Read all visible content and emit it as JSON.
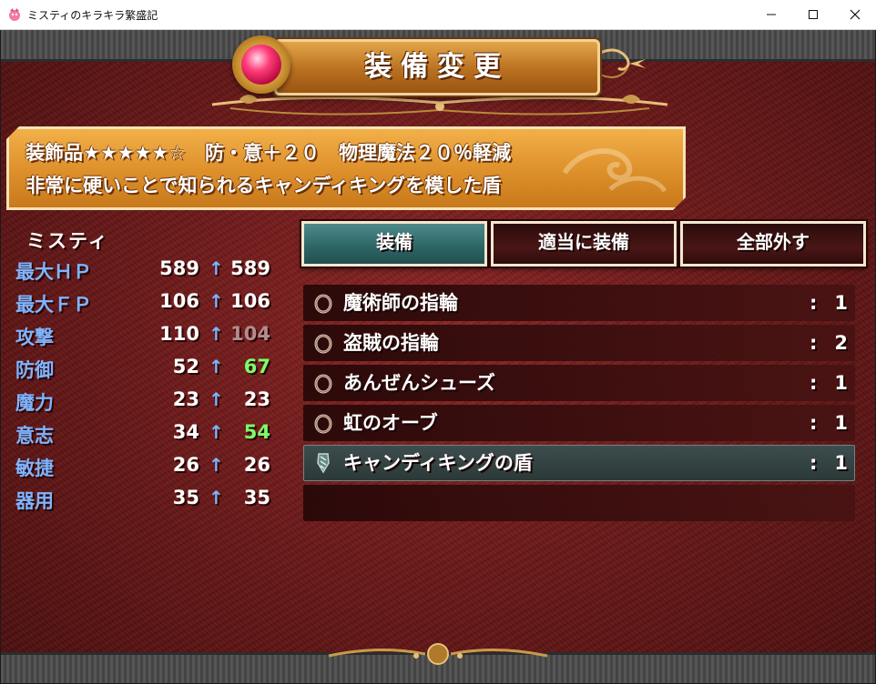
{
  "window": {
    "title": "ミスティのキラキラ繁盛記"
  },
  "scene": {
    "title": "装備変更",
    "accent_gold": "#dd8f2a",
    "background_red": "#6d1919",
    "selected_teal": "#2c6464"
  },
  "description": {
    "line1": "装飾品★★★★★☆　防・意＋２０　物理魔法２０％軽減",
    "line2": "非常に硬いことで知られるキャンディキングを模した盾"
  },
  "actor": {
    "name": "ミスティ",
    "arrow": "↑",
    "stats": [
      {
        "label": "最大ＨＰ",
        "current": "589",
        "new": "589",
        "change": "same"
      },
      {
        "label": "最大ＦＰ",
        "current": "106",
        "new": "106",
        "change": "same"
      },
      {
        "label": "攻撃",
        "current": "110",
        "new": "104",
        "change": "down"
      },
      {
        "label": "防御",
        "current": "52",
        "new": "67",
        "change": "up"
      },
      {
        "label": "魔力",
        "current": "23",
        "new": "23",
        "change": "same"
      },
      {
        "label": "意志",
        "current": "34",
        "new": "54",
        "change": "up"
      },
      {
        "label": "敏捷",
        "current": "26",
        "new": "26",
        "change": "same"
      },
      {
        "label": "器用",
        "current": "35",
        "new": "35",
        "change": "same"
      }
    ]
  },
  "commands": [
    {
      "label": "装備",
      "selected": true
    },
    {
      "label": "適当に装備",
      "selected": false
    },
    {
      "label": "全部外す",
      "selected": false
    }
  ],
  "items": [
    {
      "name": "魔術師の指輪",
      "colon": ":",
      "count": "1",
      "icon": "ring-icon",
      "selected": false
    },
    {
      "name": "盗賊の指輪",
      "colon": ":",
      "count": "2",
      "icon": "ring-icon",
      "selected": false
    },
    {
      "name": "あんぜんシューズ",
      "colon": ":",
      "count": "1",
      "icon": "ring-icon",
      "selected": false
    },
    {
      "name": "虹のオーブ",
      "colon": ":",
      "count": "1",
      "icon": "ring-icon",
      "selected": false
    },
    {
      "name": "キャンディキングの盾",
      "colon": ":",
      "count": "1",
      "icon": "shield-icon",
      "selected": true
    }
  ]
}
